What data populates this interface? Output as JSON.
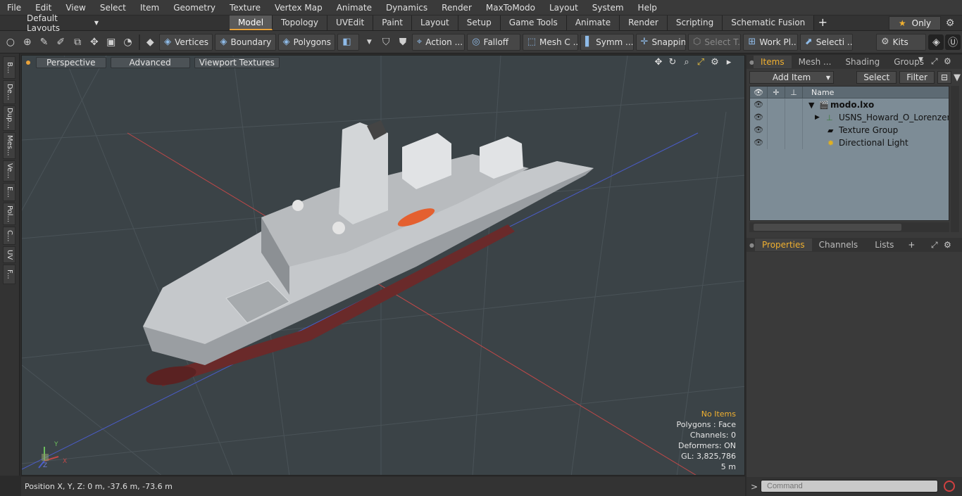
{
  "menubar": [
    "File",
    "Edit",
    "View",
    "Select",
    "Item",
    "Geometry",
    "Texture",
    "Vertex Map",
    "Animate",
    "Dynamics",
    "Render",
    "MaxToModo",
    "Layout",
    "System",
    "Help"
  ],
  "layouts": "Default Layouts",
  "tabs": [
    "Model",
    "Topology",
    "UVEdit",
    "Paint",
    "Layout",
    "Setup",
    "Game Tools",
    "Animate",
    "Render",
    "Scripting",
    "Schematic Fusion"
  ],
  "active_tab": "Model",
  "only_label": "Only",
  "toolbar": {
    "vertices": "Vertices",
    "boundary": "Boundary",
    "polygons": "Polygons",
    "action": "Action ...",
    "falloff": "Falloff",
    "mesh": "Mesh C ...",
    "symm": "Symm ...",
    "snapping": "Snapping",
    "select_t": "Select T...",
    "workpl": "Work Pl...",
    "selecti": "Selecti ...",
    "kits": "Kits"
  },
  "left_tabs": [
    "B...",
    "De...",
    "Dup...",
    "Mes...",
    "Ve...",
    "E...",
    "Pol...",
    "C...",
    "UV",
    "F..."
  ],
  "viewport": {
    "view": "Perspective",
    "advanced": "Advanced",
    "textures": "Viewport Textures",
    "info": {
      "no_items": "No Items",
      "polygons": "Polygons : Face",
      "channels": "Channels: 0",
      "deformers": "Deformers: ON",
      "gl": "GL: 3,825,786",
      "scale": "5 m"
    },
    "axis_y": "Y",
    "axis_x": "X",
    "axis_z": "Z"
  },
  "status": "Position X, Y, Z:   0 m, -37.6 m, -73.6 m",
  "right": {
    "tabs": [
      "Items",
      "Mesh ...",
      "Shading",
      "Groups"
    ],
    "add_item": "Add Item",
    "select": "Select",
    "filter": "Filter",
    "col_name": "Name",
    "tree": [
      {
        "label": "modo.lxo",
        "bold": true
      },
      {
        "label": "USNS_Howard_O_Lorenzen_ ..."
      },
      {
        "label": "Texture Group"
      },
      {
        "label": "Directional Light"
      }
    ],
    "prop_tabs": [
      "Properties",
      "Channels",
      "Lists"
    ],
    "command_placeholder": "Command"
  }
}
